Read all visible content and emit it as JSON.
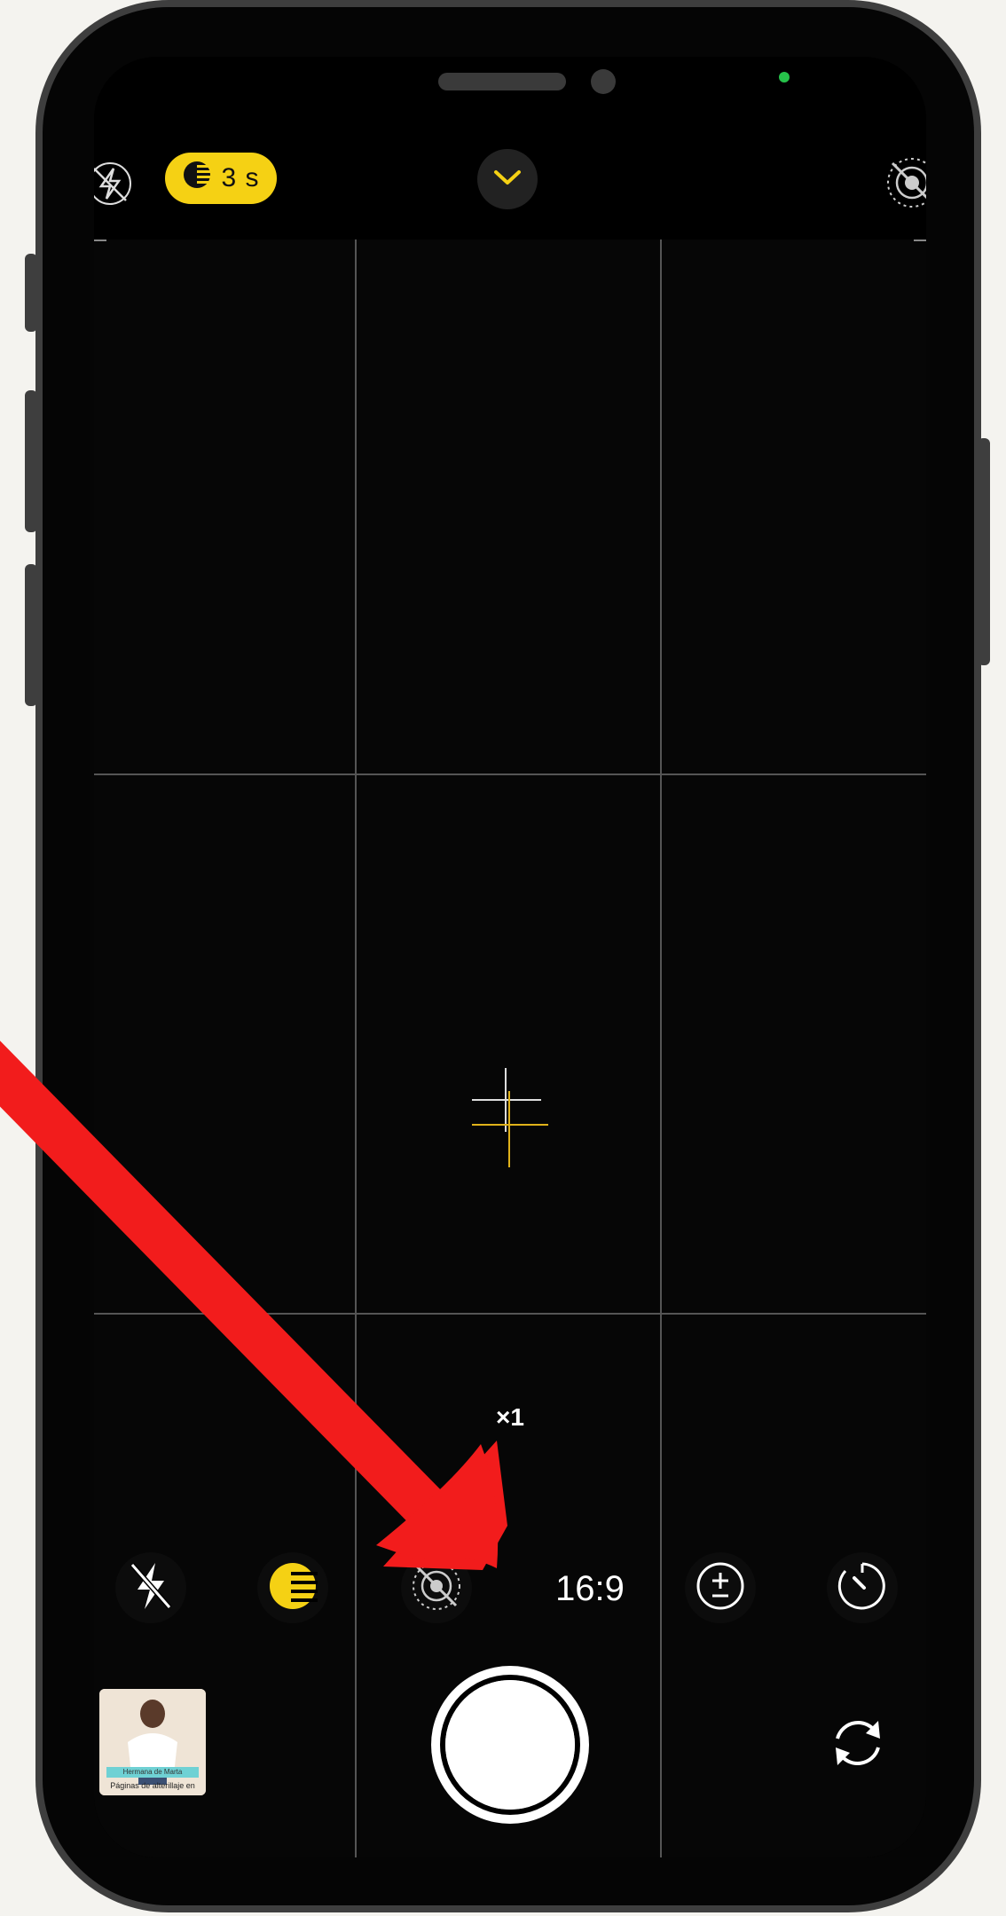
{
  "top_bar": {
    "flash_icon": "flash-off-icon",
    "night_mode_duration": "3 s",
    "night_mode_icon": "night-mode-icon",
    "expand_icon": "chevron-down-icon",
    "live_photo_icon": "live-photo-off-icon"
  },
  "viewfinder": {
    "grid": "3x3",
    "focus_icon": "focus-crosshair-icon"
  },
  "zoom": {
    "label": "×1"
  },
  "controls": {
    "flash_icon": "flash-off-icon",
    "night_mode_icon": "night-mode-icon",
    "live_photo_icon": "live-photo-off-icon",
    "aspect_ratio": "16:9",
    "exposure_icon": "exposure-icon",
    "timer_icon": "timer-icon"
  },
  "bottom_bar": {
    "thumbnail_line1": "Hermana de Marta",
    "thumbnail_line2": "Páginas de alterillaje en",
    "shutter_icon": "shutter-button",
    "switch_camera_icon": "switch-camera-icon"
  },
  "colors": {
    "accent_yellow": "#f5d114",
    "annotation_red": "#f21c1c",
    "grid_line": "#555555"
  }
}
